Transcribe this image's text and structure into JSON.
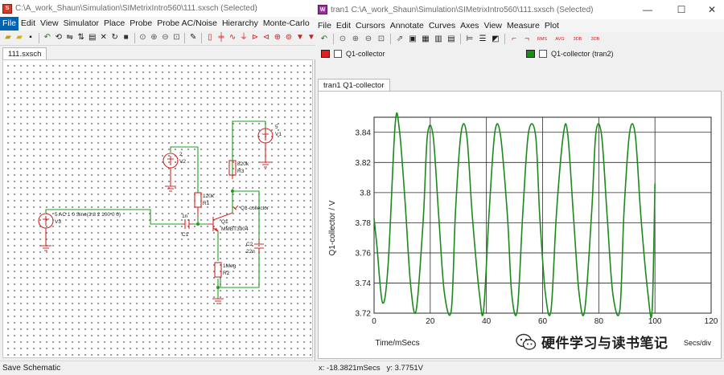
{
  "schematic_window": {
    "title": "C:\\A_work_Shaun\\Simulation\\SIMetrixIntro560\\111.sxsch (Selected)",
    "menu": [
      "File",
      "Edit",
      "View",
      "Simulator",
      "Place",
      "Probe",
      "Probe AC/Noise",
      "Hierarchy",
      "Monte-Carlo"
    ],
    "active_menu": "File",
    "tab": "111.sxsch",
    "status": "Save Schematic",
    "components": {
      "v3_label": "V3",
      "v3_value": "5 AC 1 0 Sine(3.8 2 100 0 0)",
      "v2_label": "V2",
      "v2_value": "2",
      "v1_label": "V1",
      "v1_value": "5",
      "r1_label": "R1",
      "r1_value": "120k",
      "r3_label": "R3",
      "r3_value": "820k",
      "r2_label": "R2",
      "r2_value": "1Meg",
      "c1_label": "C1",
      "c1_value": "1n",
      "c2_label": "C2",
      "c2_value": "22n",
      "q1_label": "Q1",
      "q1_model": "MMBT3904",
      "probe_label": "Q1-collector"
    }
  },
  "waveform_window": {
    "title": "tran1 C:\\A_work_Shaun\\Simulation\\SIMetrixIntro560\\111.sxsch (Selected)",
    "menu": [
      "File",
      "Edit",
      "Cursors",
      "Annotate",
      "Curves",
      "Axes",
      "View",
      "Measure",
      "Plot"
    ],
    "toolbar_text": [
      "RMS",
      "AVG",
      "3DB",
      "3DB"
    ],
    "legend": [
      {
        "name": "Q1-collector",
        "color": "#e02020"
      },
      {
        "name": "Q1-collector (tran2)",
        "color": "#1a8a1a"
      }
    ],
    "tab": "tran1 Q1-collector",
    "status_x": "x: -18.3821mSecs",
    "status_y": "y: 3.7751V"
  },
  "chart_data": {
    "type": "line",
    "title": "",
    "xlabel": "Time/mSecs",
    "ylabel": "Q1-collector / V",
    "xlim": [
      0,
      120
    ],
    "ylim": [
      3.72,
      3.85
    ],
    "x_ticks": [
      0,
      20,
      40,
      60,
      80,
      100,
      120
    ],
    "y_ticks": [
      3.72,
      3.74,
      3.76,
      3.78,
      3.8,
      3.82,
      3.84
    ],
    "x_tick_labels": [
      "0",
      "20",
      "40",
      "60",
      "80",
      "100",
      "120"
    ],
    "y_tick_labels": [
      "3.72",
      "3.74",
      "3.76",
      "3.78",
      "3.8",
      "3.82",
      "3.84"
    ],
    "div_label_fragment": "Secs/div",
    "grid": true,
    "series": [
      {
        "name": "Q1-collector",
        "color": "#1a8a1a",
        "x": [
          0,
          1,
          3,
          5,
          7.5,
          9,
          11,
          13,
          15,
          17.5,
          19,
          21,
          23,
          25,
          27.5,
          29,
          31,
          33,
          35,
          37.5,
          39,
          41,
          43,
          45,
          47.5,
          49,
          51,
          53,
          55,
          57.5,
          59,
          61,
          63,
          65,
          67.5,
          69,
          71,
          73,
          75,
          77.5,
          79,
          81,
          83,
          85,
          87.5,
          89,
          91,
          93,
          95,
          97.5,
          99,
          100
        ],
        "values": [
          3.783,
          3.765,
          3.727,
          3.752,
          3.845,
          3.842,
          3.795,
          3.739,
          3.722,
          3.782,
          3.838,
          3.838,
          3.785,
          3.734,
          3.722,
          3.788,
          3.84,
          3.838,
          3.784,
          3.733,
          3.722,
          3.788,
          3.84,
          3.838,
          3.784,
          3.733,
          3.722,
          3.788,
          3.84,
          3.838,
          3.784,
          3.733,
          3.722,
          3.788,
          3.84,
          3.838,
          3.784,
          3.733,
          3.722,
          3.788,
          3.84,
          3.838,
          3.784,
          3.733,
          3.722,
          3.788,
          3.84,
          3.838,
          3.784,
          3.733,
          3.722,
          3.806
        ]
      }
    ]
  },
  "watermark": "硬件学习与读书笔记"
}
